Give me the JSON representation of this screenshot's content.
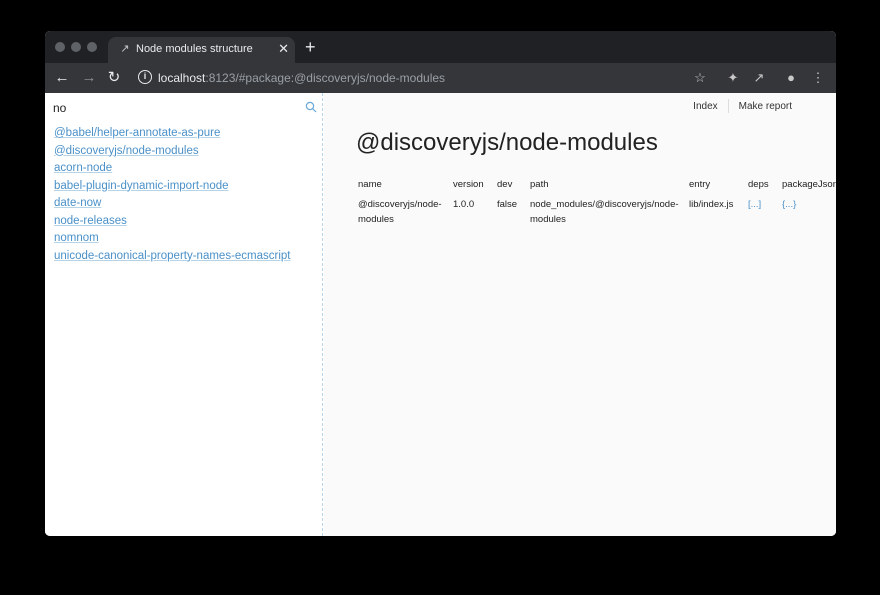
{
  "browser": {
    "tab_title": "Node modules structure",
    "url_host": "localhost",
    "url_rest": ":8123/#package:@discoveryjs/node-modules"
  },
  "sidebar": {
    "search_value": "no",
    "packages": [
      "@babel/helper-annotate-as-pure",
      "@discoveryjs/node-modules",
      "acorn-node",
      "babel-plugin-dynamic-import-node",
      "date-now",
      "node-releases",
      "nomnom",
      "unicode-canonical-property-names-ecmascript"
    ]
  },
  "topnav": {
    "index_label": "Index",
    "report_label": "Make report"
  },
  "main": {
    "title": "@discoveryjs/node-modules",
    "table": {
      "headers": [
        "name",
        "version",
        "dev",
        "path",
        "entry",
        "deps",
        "packageJson"
      ],
      "row": {
        "name_line1": "@discoveryjs/node-",
        "name_line2": "modules",
        "version": "1.0.0",
        "dev": "false",
        "path_line1": "node_modules/@discoveryjs/node-",
        "path_line2": "modules",
        "entry": "lib/index.js",
        "deps": "[...]",
        "packageJson": "{...}"
      }
    }
  },
  "colors": {
    "link": "#4a90c8",
    "chrome_dark": "#202124",
    "toolbar": "#35363a"
  }
}
